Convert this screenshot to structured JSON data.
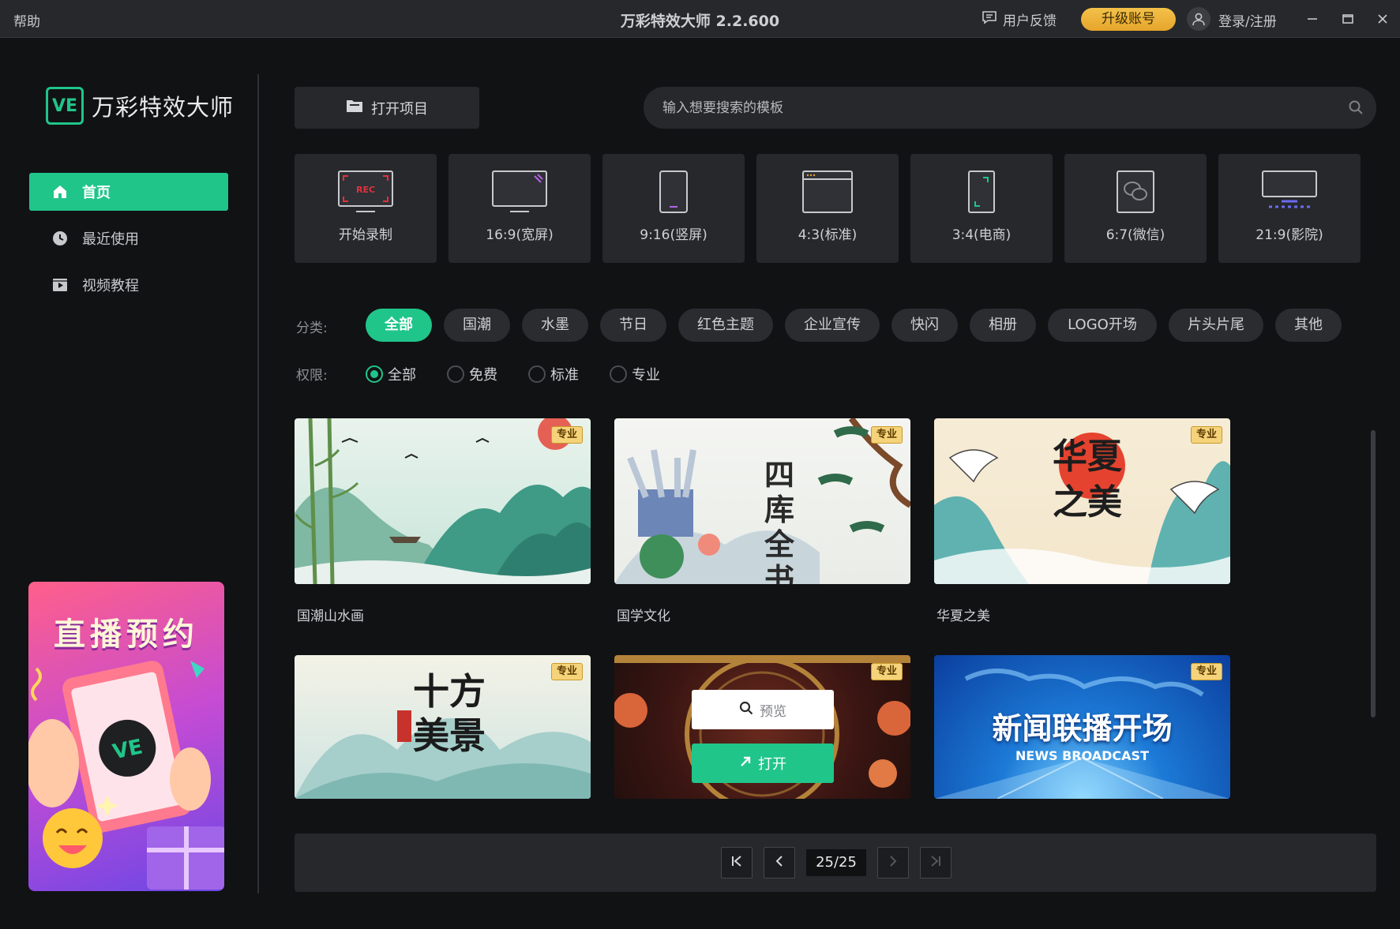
{
  "titlebar": {
    "help": "帮助",
    "title": "万彩特效大师 2.2.600",
    "feedback": "用户反馈",
    "upgrade": "升级账号",
    "login": "登录/注册"
  },
  "sidebar": {
    "logo_mark": "VE",
    "logo_text": "万彩特效大师",
    "items": [
      {
        "label": "首页",
        "icon": "home-icon",
        "active": true
      },
      {
        "label": "最近使用",
        "icon": "clock-icon",
        "active": false
      },
      {
        "label": "视频教程",
        "icon": "video-icon",
        "active": false
      }
    ],
    "promo": {
      "title": "直播预约",
      "mark": "VE"
    }
  },
  "toolbar": {
    "open_project": "打开项目",
    "search_placeholder": "输入想要搜索的模板"
  },
  "formats": [
    {
      "label": "开始录制",
      "icon": "record-icon",
      "badge": "REC"
    },
    {
      "label": "16:9(宽屏)",
      "icon": "widescreen-icon"
    },
    {
      "label": "9:16(竖屏)",
      "icon": "portrait-icon"
    },
    {
      "label": "4:3(标准)",
      "icon": "standard-icon"
    },
    {
      "label": "3:4(电商)",
      "icon": "ecommerce-icon"
    },
    {
      "label": "6:7(微信)",
      "icon": "wechat-icon"
    },
    {
      "label": "21:9(影院)",
      "icon": "cinema-icon"
    }
  ],
  "filters": {
    "category_label": "分类:",
    "categories": [
      "全部",
      "国潮",
      "水墨",
      "节日",
      "红色主题",
      "企业宣传",
      "快闪",
      "相册",
      "LOGO开场",
      "片头片尾",
      "其他"
    ],
    "active_category": "全部",
    "permission_label": "权限:",
    "permissions": [
      "全部",
      "免费",
      "标准",
      "专业"
    ],
    "active_permission": "全部"
  },
  "templates": [
    {
      "title": "国潮山水画",
      "badge": "专业"
    },
    {
      "title": "国学文化",
      "badge": "专业",
      "art_text": "四库全书"
    },
    {
      "title": "华夏之美",
      "badge": "专业",
      "art_text": "华夏之美"
    },
    {
      "title": "",
      "badge": "专业",
      "art_text": "十方美景"
    },
    {
      "title": "",
      "badge": "专业",
      "hover": {
        "preview": "预览",
        "open": "打开"
      }
    },
    {
      "title": "",
      "badge": "专业",
      "art_text": "新闻联播开场",
      "art_subtext": "NEWS BROADCAST"
    }
  ],
  "pagination": {
    "current": "25/25"
  },
  "colors": {
    "accent": "#20c58a",
    "upgrade": "#e6a52b",
    "badge": "#f5d37a",
    "panel": "#26282c",
    "background": "#111214"
  }
}
